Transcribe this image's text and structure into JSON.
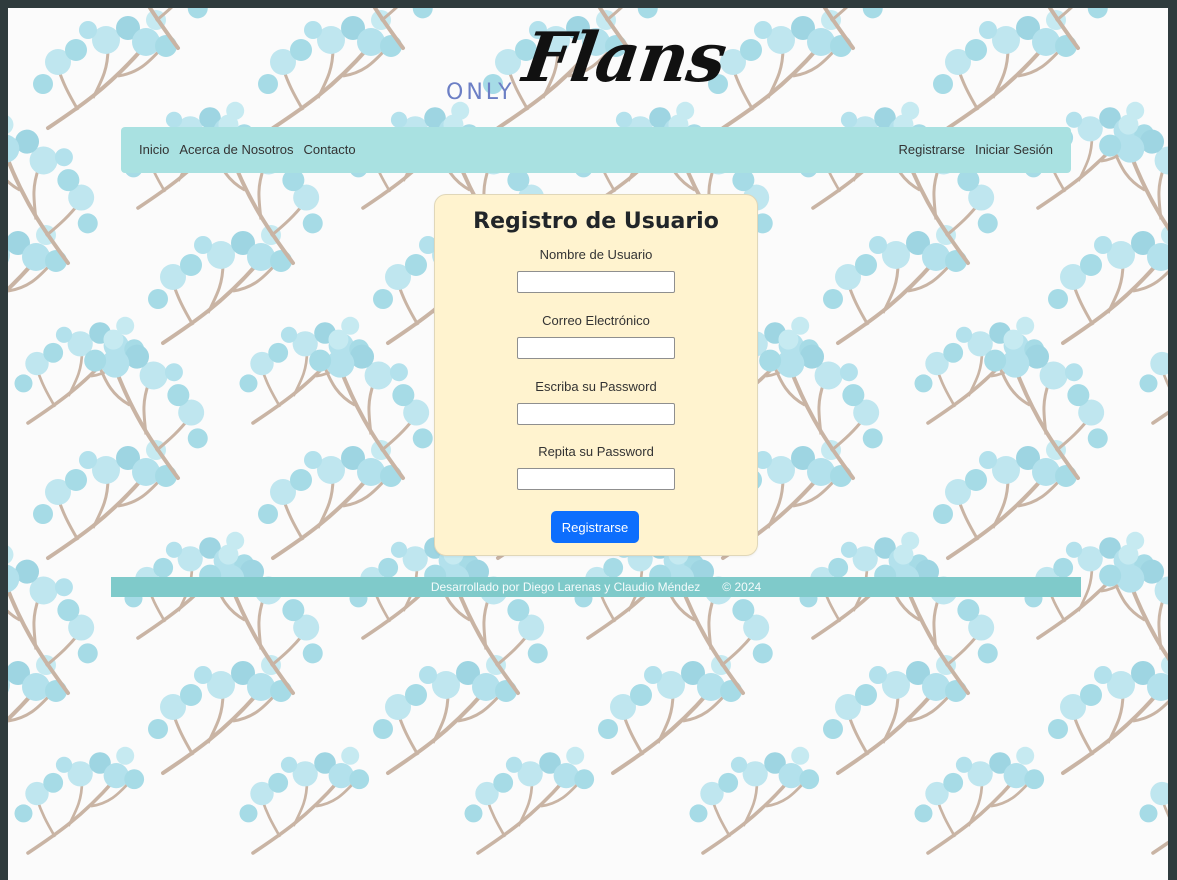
{
  "logo": {
    "prefix": "ONLY",
    "name": "Flans"
  },
  "nav": {
    "left": [
      "Inicio",
      "Acerca de Nosotros",
      "Contacto"
    ],
    "right": [
      "Registrarse",
      "Iniciar Sesión"
    ]
  },
  "form": {
    "title": "Registro de Usuario",
    "fields": [
      {
        "label": "Nombre de Usuario",
        "value": ""
      },
      {
        "label": "Correo Electrónico",
        "value": ""
      },
      {
        "label": "Escriba su Password",
        "value": ""
      },
      {
        "label": "Repita su Password",
        "value": ""
      }
    ],
    "submit_label": "Registrarse"
  },
  "footer": {
    "credits": "Desarrollado por Diego Larenas y Claudio Méndez",
    "year": "© 2024"
  },
  "colors": {
    "navbar": "#a9e1e1",
    "footer": "#7fcaca",
    "card": "#fff3cf",
    "button": "#0d6efd",
    "pattern": "#a6dbe6"
  }
}
